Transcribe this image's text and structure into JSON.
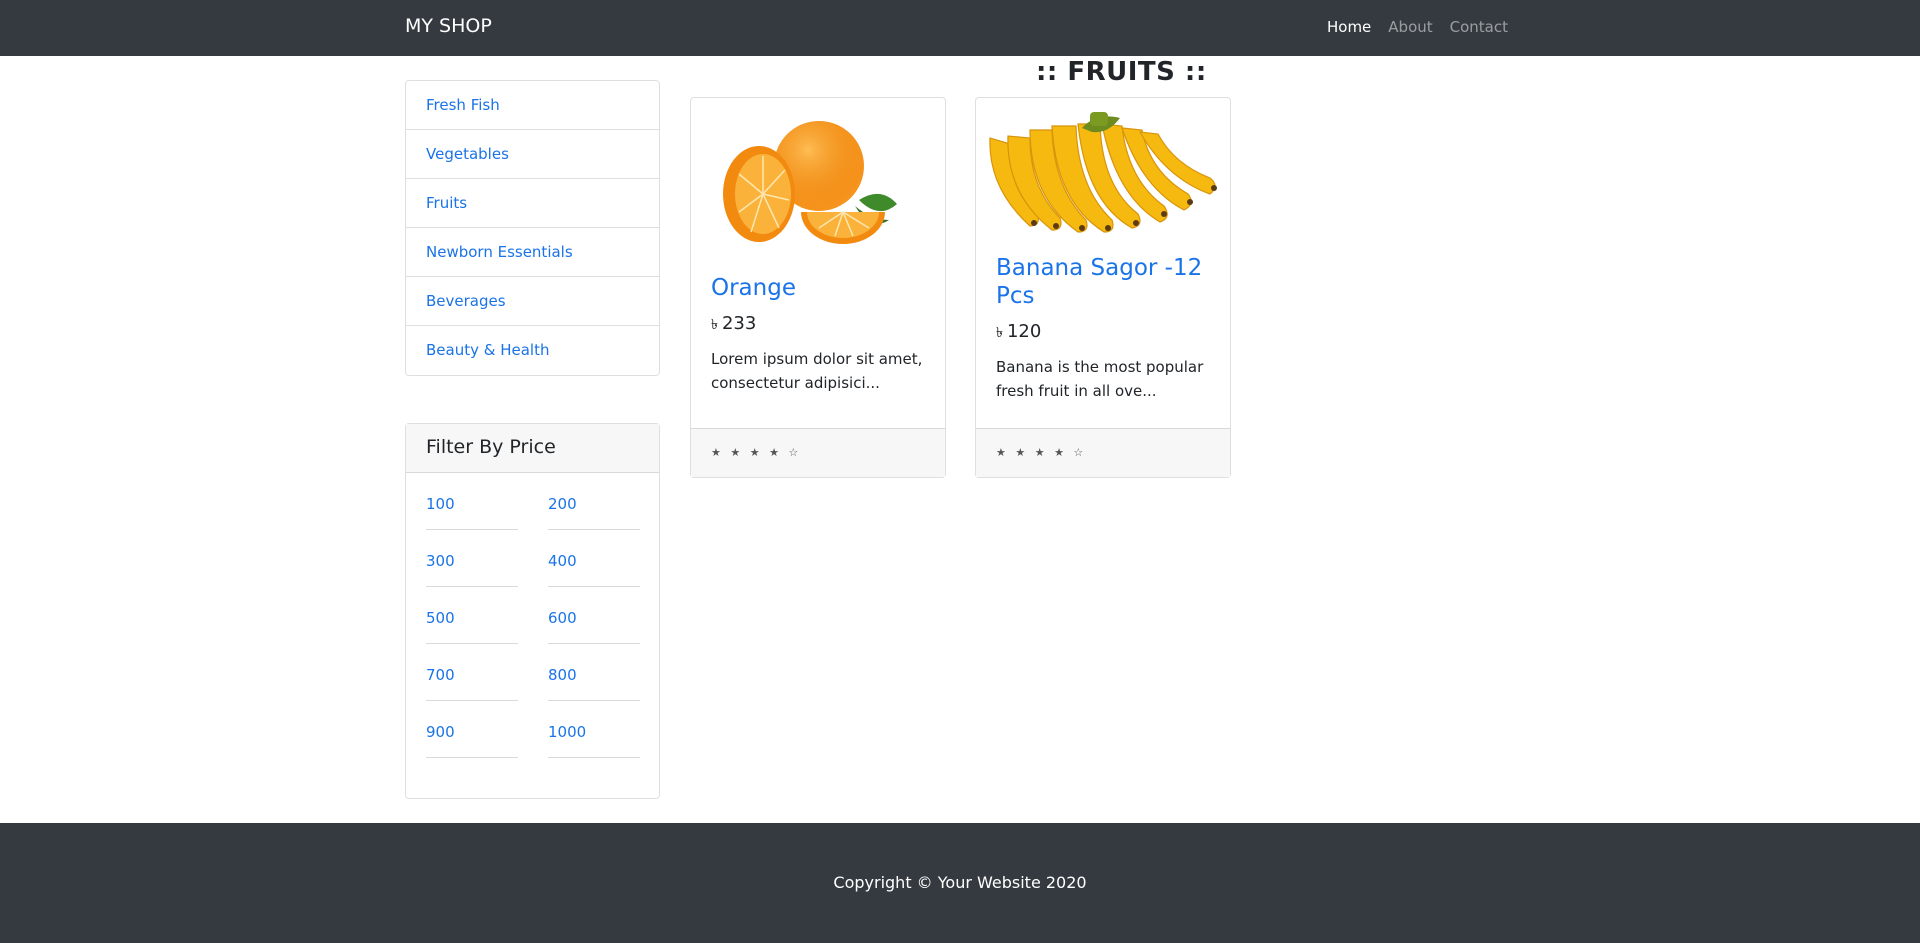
{
  "navbar": {
    "brand": "MY SHOP",
    "links": [
      {
        "label": "Home",
        "active": true
      },
      {
        "label": "About",
        "active": false
      },
      {
        "label": "Contact",
        "active": false
      }
    ]
  },
  "sidebar": {
    "categories": [
      "Fresh Fish",
      "Vegetables",
      "Fruits",
      "Newborn Essentials",
      "Beverages",
      "Beauty & Health"
    ]
  },
  "filter": {
    "title": "Filter By Price",
    "prices": [
      "100",
      "200",
      "300",
      "400",
      "500",
      "600",
      "700",
      "800",
      "900",
      "1000"
    ]
  },
  "page": {
    "title": ":: FRUITS ::"
  },
  "products": [
    {
      "name": "Orange",
      "currency": "৳",
      "price": "233",
      "description": "Lorem ipsum dolor sit amet, consectetur adipisici...",
      "rating_stars": "★ ★ ★ ★ ☆",
      "rating": 4,
      "image_icon": "orange-image"
    },
    {
      "name": "Banana Sagor -12 Pcs",
      "currency": "৳",
      "price": "120",
      "description": "Banana is the most popular fresh fruit in all ove...",
      "rating_stars": "★ ★ ★ ★ ☆",
      "rating": 4,
      "image_icon": "banana-image"
    }
  ],
  "footer": {
    "copyright": "Copyright © Your Website 2020"
  },
  "colors": {
    "navbar_bg": "#343a40",
    "link": "#1a73e8",
    "footer_bg": "#343a40"
  }
}
